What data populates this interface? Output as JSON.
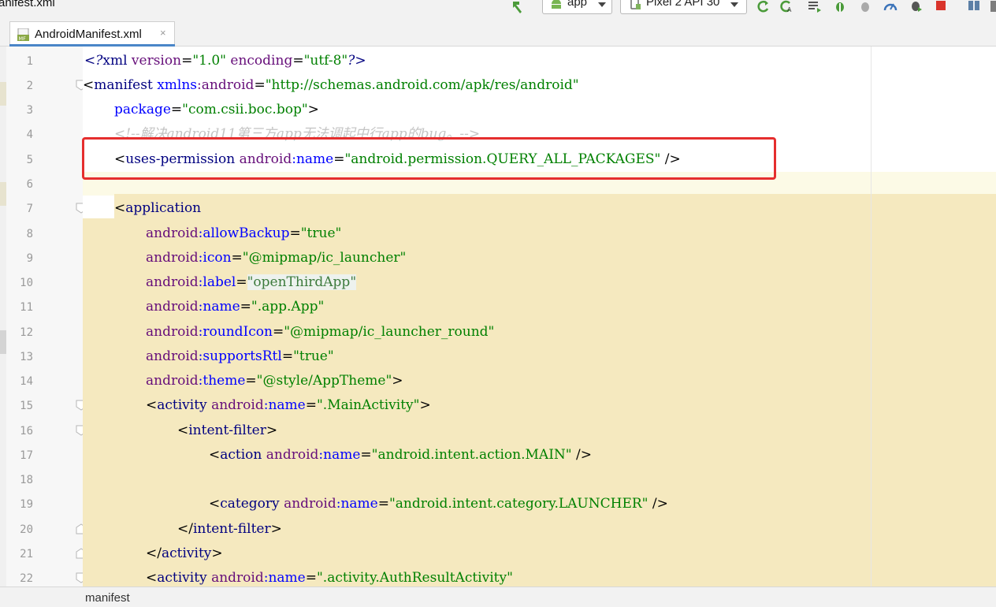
{
  "toolbar": {
    "crumb": "anifest.xml",
    "module_combo": "app",
    "device_combo": "Pixel 2 API 30"
  },
  "tabs": [
    {
      "label": "AndroidManifest.xml",
      "close": "×",
      "icon": "MF"
    }
  ],
  "editor": {
    "line_numbers": [
      "1",
      "2",
      "3",
      "4",
      "5",
      "6",
      "7",
      "8",
      "9",
      "10",
      "11",
      "12",
      "13",
      "14",
      "15",
      "16",
      "17",
      "18",
      "19",
      "20",
      "21",
      "22"
    ],
    "l1": {
      "open": "<?",
      "tag": "xml",
      "a1": "version",
      "eq1": "=",
      "v1": "\"1.0\"",
      "a2": "encoding",
      "eq2": "=",
      "v2": "\"utf-8\"",
      "close": "?>"
    },
    "l2": {
      "open": "<",
      "tag": "manifest",
      "a1p": "xmlns",
      "a1c": ":",
      "a1n": "android",
      "eq": "=",
      "v": "\"http://schemas.android.com/apk/res/android\""
    },
    "l3": {
      "attr": "package",
      "eq": "=",
      "v": "\"com.csii.boc.bop\"",
      "close": ">"
    },
    "l4": {
      "comment": "<!--解决android11第三方app无法调起中行app的bug。-->"
    },
    "l5": {
      "open": "<",
      "tag": "uses-permission",
      "ap": "android",
      "ac": ":",
      "an": "name",
      "eq": "=",
      "v": "\"android.permission.QUERY_ALL_PACKAGES\"",
      "close": " />"
    },
    "l7": {
      "open": "<",
      "tag": "application"
    },
    "l8": {
      "ap": "android",
      "ac": ":",
      "an": "allowBackup",
      "eq": "=",
      "v": "\"true\""
    },
    "l9": {
      "ap": "android",
      "ac": ":",
      "an": "icon",
      "eq": "=",
      "v": "\"@mipmap/ic_launcher\""
    },
    "l10": {
      "ap": "android",
      "ac": ":",
      "an": "label",
      "eq": "=",
      "v": "\"openThirdApp\""
    },
    "l11": {
      "ap": "android",
      "ac": ":",
      "an": "name",
      "eq": "=",
      "v": "\".app.App\""
    },
    "l12": {
      "ap": "android",
      "ac": ":",
      "an": "roundIcon",
      "eq": "=",
      "v": "\"@mipmap/ic_launcher_round\""
    },
    "l13": {
      "ap": "android",
      "ac": ":",
      "an": "supportsRtl",
      "eq": "=",
      "v": "\"true\""
    },
    "l14": {
      "ap": "android",
      "ac": ":",
      "an": "theme",
      "eq": "=",
      "v": "\"@style/AppTheme\"",
      "close": ">"
    },
    "l15": {
      "open": "<",
      "tag": "activity",
      "ap": "android",
      "ac": ":",
      "an": "name",
      "eq": "=",
      "v": "\".MainActivity\"",
      "close": ">"
    },
    "l16": {
      "open": "<",
      "tag": "intent-filter",
      "close": ">"
    },
    "l17": {
      "open": "<",
      "tag": "action",
      "ap": "android",
      "ac": ":",
      "an": "name",
      "eq": "=",
      "v": "\"android.intent.action.MAIN\"",
      "close": " />"
    },
    "l19": {
      "open": "<",
      "tag": "category",
      "ap": "android",
      "ac": ":",
      "an": "name",
      "eq": "=",
      "v": "\"android.intent.category.LAUNCHER\"",
      "close": " />"
    },
    "l20": {
      "open": "</",
      "tag": "intent-filter",
      "close": ">"
    },
    "l21": {
      "open": "</",
      "tag": "activity",
      "close": ">"
    },
    "l22": {
      "open": "<",
      "tag": "activity",
      "ap": "android",
      "ac": ":",
      "an": "name",
      "eq": "=",
      "v": "\".activity.AuthResultActivity\""
    }
  },
  "status": {
    "breadcrumb": "manifest"
  },
  "colors": {
    "highlight": "#f5e9bf",
    "annotation_box": "#e52e2e",
    "tag": "#000080",
    "attribute": "#660e7a",
    "value": "#008000",
    "comment": "#8c8c8c"
  }
}
